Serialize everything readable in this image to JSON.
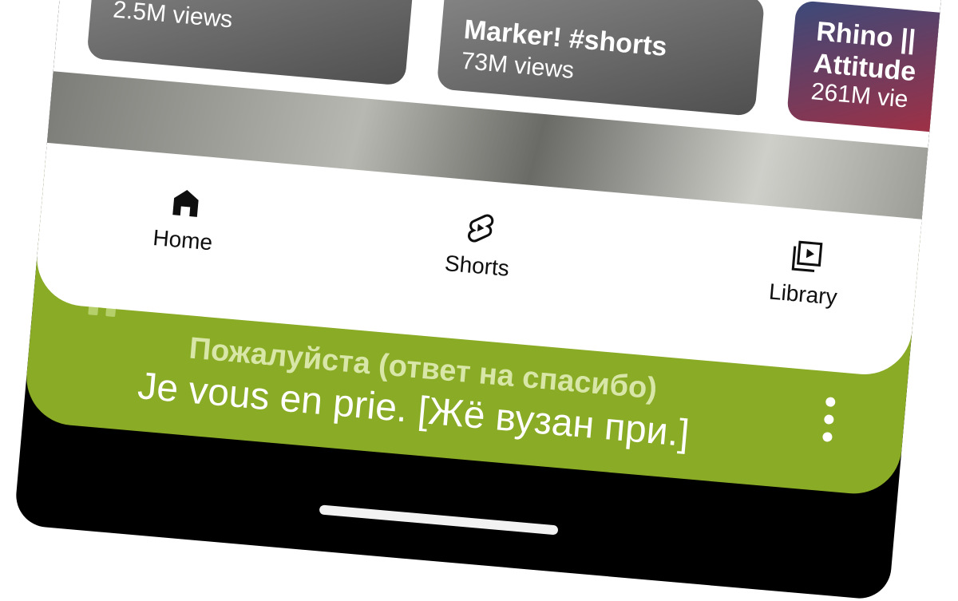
{
  "feed": {
    "cards": [
      {
        "title": "",
        "views": "2.5M views"
      },
      {
        "title": "Marker! #shorts",
        "views": "73M views"
      },
      {
        "title": "Rhino ||",
        "title2": "Attitude",
        "views": "261M vie"
      }
    ]
  },
  "nav": {
    "home": {
      "label": "Home",
      "icon": "home-icon"
    },
    "shorts": {
      "label": "Shorts",
      "icon": "shorts-icon"
    },
    "library": {
      "label": "Library",
      "icon": "library-icon"
    }
  },
  "captions": {
    "primary": "Пожалуйста (ответ на спасибо)",
    "secondary": "Je vous en prie. [Жё вузан при.]",
    "accent_color": "#8aab25"
  }
}
